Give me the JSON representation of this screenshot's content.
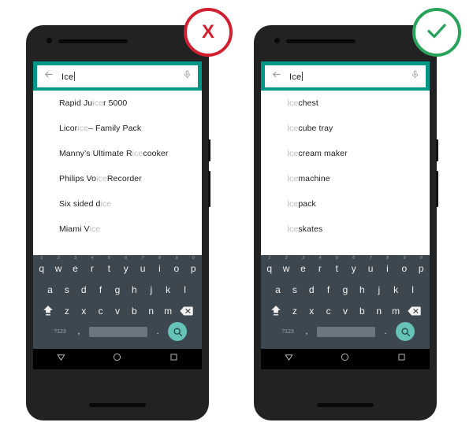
{
  "teal": "#009688",
  "bad_color": "#d32030",
  "good_color": "#27a35a",
  "phones": [
    {
      "id": "dont",
      "badge": {
        "kind": "x-icon",
        "label": "X",
        "meaning": "dont",
        "color": "#d32030"
      },
      "search": {
        "back_icon": "back-arrow-icon",
        "value": "Ice",
        "mic_icon": "microphone-icon"
      },
      "suggestions": [
        {
          "pre": "Rapid Ju",
          "match": "ice",
          "post": "r 5000"
        },
        {
          "pre": "Licor",
          "match": "ice",
          "post": " – Family Pack"
        },
        {
          "pre": "Manny’s Ultimate R",
          "match": "ice",
          "post": " cooker"
        },
        {
          "pre": "Philips Vo",
          "match": "ice",
          "post": " Recorder"
        },
        {
          "pre": "Six sided d",
          "match": "ice",
          "post": ""
        },
        {
          "pre": "Miami V",
          "match": "ice",
          "post": ""
        }
      ]
    },
    {
      "id": "do",
      "badge": {
        "kind": "check-icon",
        "label": "",
        "meaning": "do",
        "color": "#27a35a"
      },
      "search": {
        "back_icon": "back-arrow-icon",
        "value": "Ice",
        "mic_icon": "microphone-icon"
      },
      "suggestions": [
        {
          "pre": "",
          "match": "Ice",
          "post": " chest"
        },
        {
          "pre": "",
          "match": "Ice",
          "post": " cube tray"
        },
        {
          "pre": "",
          "match": "Ice",
          "post": " cream maker"
        },
        {
          "pre": "",
          "match": "Ice",
          "post": " machine"
        },
        {
          "pre": "",
          "match": "Ice",
          "post": " pack"
        },
        {
          "pre": "",
          "match": "Ice",
          "post": " skates"
        }
      ]
    }
  ],
  "keyboard": {
    "row1": [
      {
        "key": "q",
        "num": "1"
      },
      {
        "key": "w",
        "num": "2"
      },
      {
        "key": "e",
        "num": "3"
      },
      {
        "key": "r",
        "num": "4"
      },
      {
        "key": "t",
        "num": "5"
      },
      {
        "key": "y",
        "num": "6"
      },
      {
        "key": "u",
        "num": "7"
      },
      {
        "key": "i",
        "num": "8"
      },
      {
        "key": "o",
        "num": "9"
      },
      {
        "key": "p",
        "num": "0"
      }
    ],
    "row2": [
      "a",
      "s",
      "d",
      "f",
      "g",
      "h",
      "j",
      "k",
      "l"
    ],
    "row3": [
      "z",
      "x",
      "c",
      "v",
      "b",
      "n",
      "m"
    ],
    "shift_icon": "shift-key-icon",
    "delete_icon": "backspace-key-icon",
    "symbols_label": "?123",
    "comma_label": ",",
    "period_label": ".",
    "space_label": "",
    "search_icon": "search-key-icon"
  },
  "navbar": {
    "back_icon": "nav-back-triangle-icon",
    "home_icon": "nav-home-circle-icon",
    "recents_icon": "nav-recents-square-icon"
  }
}
